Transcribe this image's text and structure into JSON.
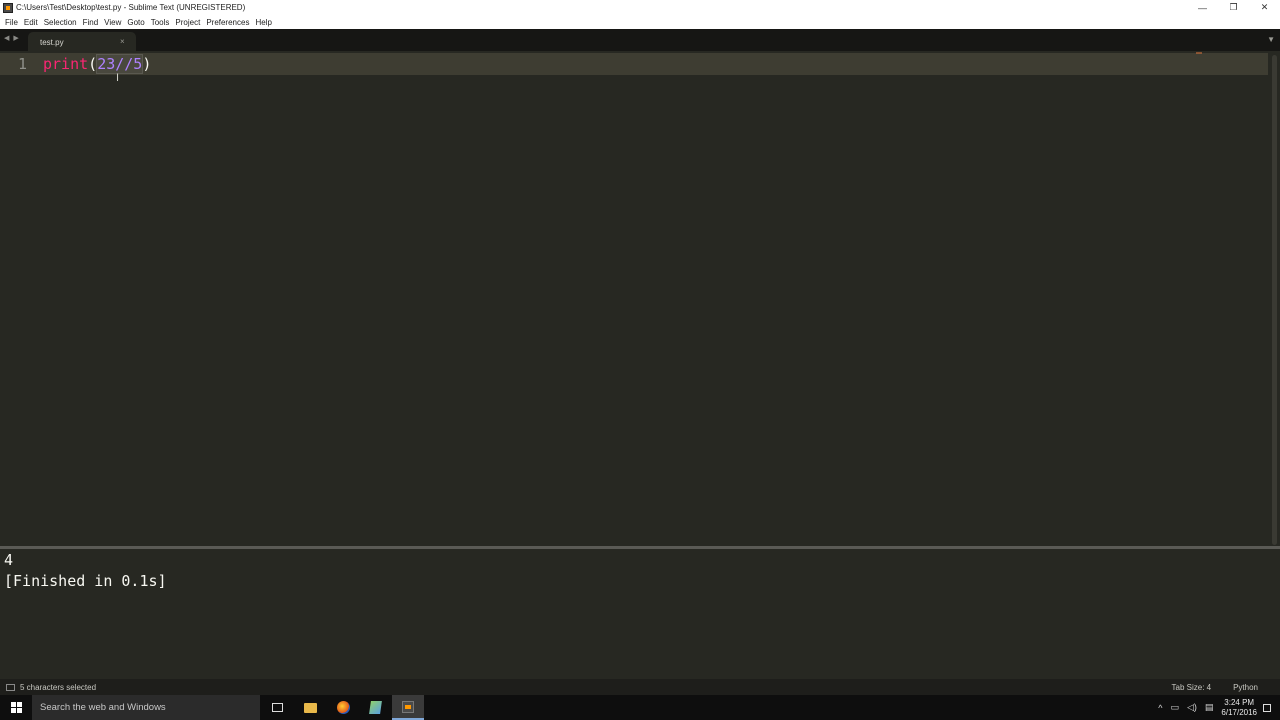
{
  "window": {
    "title": "C:\\Users\\Test\\Desktop\\test.py - Sublime Text (UNREGISTERED)",
    "controls": {
      "minimize": "—",
      "restore": "❐",
      "close": "✕"
    }
  },
  "menu": [
    "File",
    "Edit",
    "Selection",
    "Find",
    "View",
    "Goto",
    "Tools",
    "Project",
    "Preferences",
    "Help"
  ],
  "tabs": {
    "nav_back": "◀",
    "nav_forward": "▶",
    "active": {
      "label": "test.py",
      "close": "×"
    },
    "dropdown": "▼"
  },
  "editor": {
    "line_number": "1",
    "code": {
      "func": "print",
      "open_paren": "(",
      "selected": "23//5",
      "close_paren": ")"
    },
    "cursor": "I"
  },
  "output": {
    "result": "4",
    "finished": "[Finished in 0.1s]"
  },
  "status": {
    "selection": "5 characters selected",
    "tab_size": "Tab Size: 4",
    "syntax": "Python"
  },
  "taskbar": {
    "search_placeholder": "Search the web and Windows",
    "time": "3:24 PM",
    "date": "6/17/2016"
  },
  "colors": {
    "background": "#272822",
    "keyword": "#f92672",
    "number": "#ae81ff",
    "selection": "#49483e"
  }
}
